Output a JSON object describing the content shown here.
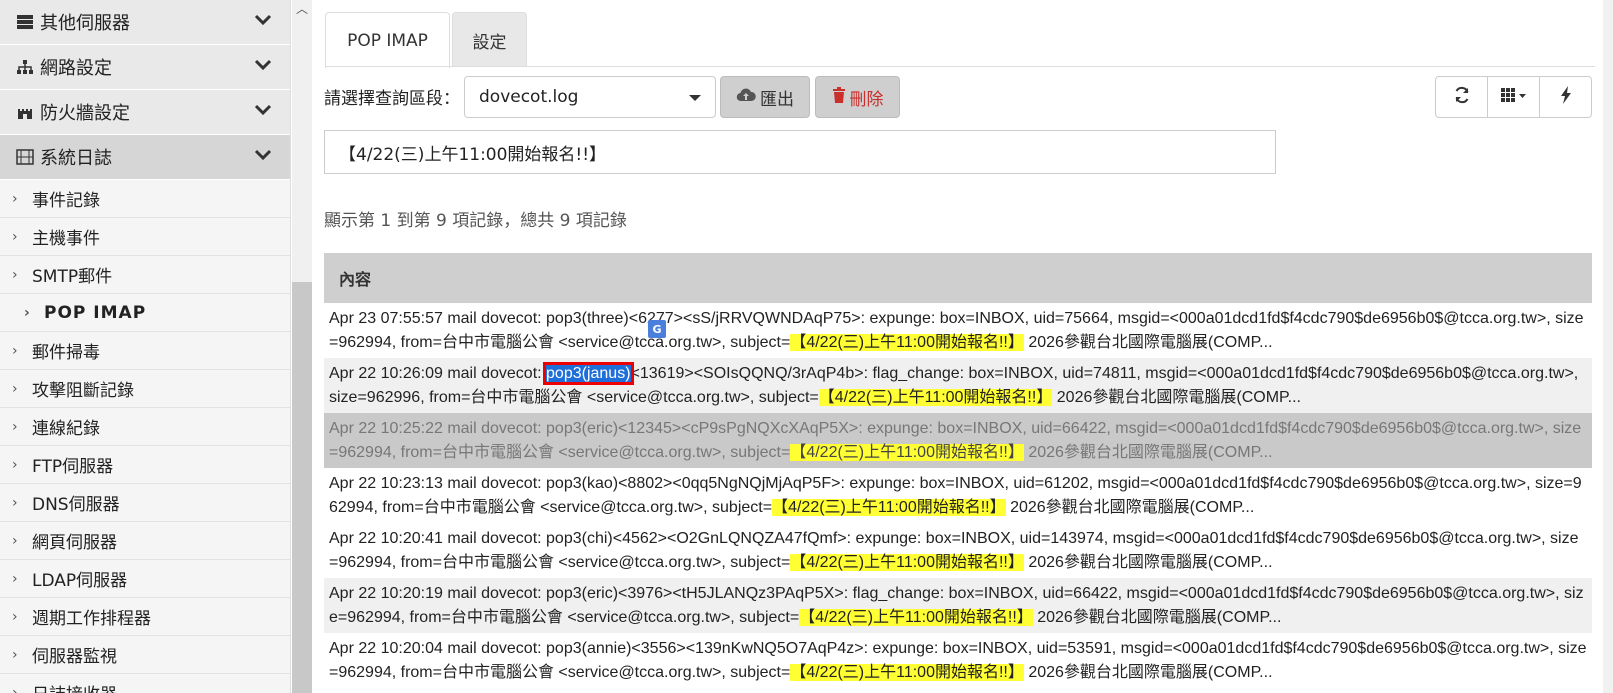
{
  "sidebar": {
    "sections": [
      {
        "label": "其他伺服器",
        "icon": "server-icon"
      },
      {
        "label": "網路設定",
        "icon": "network-icon"
      },
      {
        "label": "防火牆設定",
        "icon": "castle-icon"
      },
      {
        "label": "系統日誌",
        "icon": "film-icon"
      }
    ],
    "items": [
      {
        "label": "事件記錄"
      },
      {
        "label": "主機事件"
      },
      {
        "label": "SMTP郵件"
      },
      {
        "label": "POP IMAP"
      },
      {
        "label": "郵件掃毒"
      },
      {
        "label": "攻擊阻斷記錄"
      },
      {
        "label": "連線紀錄"
      },
      {
        "label": "FTP伺服器"
      },
      {
        "label": "DNS伺服器"
      },
      {
        "label": "網頁伺服器"
      },
      {
        "label": "LDAP伺服器"
      },
      {
        "label": "週期工作排程器"
      },
      {
        "label": "伺服器監視"
      },
      {
        "label": "日誌接收器"
      }
    ]
  },
  "tabs": [
    {
      "label": "POP IMAP"
    },
    {
      "label": "設定"
    }
  ],
  "toolbar": {
    "query_label": "請選擇查詢區段：",
    "selected_log": "dovecot.log",
    "export_label": "匯出",
    "delete_label": "刪除"
  },
  "search": {
    "value": "【4/22(三)上午11:00開始報名!!】"
  },
  "record_info": "顯示第 1 到第 9 項記錄，總共 9 項記錄",
  "table": {
    "header": "內容",
    "rows": [
      {
        "pre": "Apr 23 07:55:57 mail dovecot: pop3(three)<6277><sS/jRRVQWNDAqP75>: expunge: box=INBOX, uid=75664, msgid=<000a01dcd1fd$f4cdc790$de6956b0$@tcca.org.tw>, size=962994, from=台中市電腦公會 <se",
        "mid": "rvice@tcca.org.tw>, subject=",
        "hl": "【4/22(三)上午11:00開始報名!!】",
        "post": " 2026參觀台北國際電腦展(COMP..."
      },
      {
        "pre": "Apr 22 10:26:09 mail dovecot: ",
        "sel": "pop3(janus)",
        "mid": "<13619><SOIsQQNQ/3rAqP4b>: flag_change: box=INBOX, uid=74811, msgid=<000a01dcd1fd$f4cdc790$de6956b0$@tcca.org.tw>, size=962996, from=台中市電腦公會 <service@tcca.org.tw>, subject=",
        "hl": "【4/22(三)上午11:00開始報名!!】",
        "post": " 2026參觀台北國際電腦展(COMP..."
      },
      {
        "pre": "Apr 22 10:25:22 mail dovecot: pop3(eric)<12345><cP9sPgNQXcXAqP5X>: expunge: box=INBOX, uid=66422, msgid=<000a01dcd1fd$f4cdc790$de6956b0$@tcca.org.tw>, size=962994, from=台中市電腦公會 <service@tcca.org.tw>, subject=",
        "hl": "【4/22(三)上午11:00開始報名!!】",
        "post": " 2026參觀台北國際電腦展(COMP..."
      },
      {
        "pre": "Apr 22 10:23:13 mail dovecot: pop3(kao)<8802><0qq5NgNQjMjAqP5F>: expunge: box=INBOX, uid=61202, msgid=<000a01dcd1fd$f4cdc790$de6956b0$@tcca.org.tw>, size=962994, from=台中市電腦公會 <service@tcca.org.tw>, subject=",
        "hl": "【4/22(三)上午11:00開始報名!!】",
        "post": " 2026參觀台北國際電腦展(COMP..."
      },
      {
        "pre": "Apr 22 10:20:41 mail dovecot: pop3(chi)<4562><O2GnLQNQZA47fQmf>: expunge: box=INBOX, uid=143974, msgid=<000a01dcd1fd$f4cdc790$de6956b0$@tcca.org.tw>, size=962994, from=台中市電腦公會 <service@tcca.org.tw>, subject=",
        "hl": "【4/22(三)上午11:00開始報名!!】",
        "post": " 2026參觀台北國際電腦展(COMP..."
      },
      {
        "pre": "Apr 22 10:20:19 mail dovecot: pop3(eric)<3976><tH5JLANQz3PAqP5X>: flag_change: box=INBOX, uid=66422, msgid=<000a01dcd1fd$f4cdc790$de6956b0$@tcca.org.tw>, size=962994, from=台中市電腦公會 <service@tcca.org.tw>, subject=",
        "hl": "【4/22(三)上午11:00開始報名!!】",
        "post": " 2026參觀台北國際電腦展(COMP..."
      },
      {
        "pre": "Apr 22 10:20:04 mail dovecot: pop3(annie)<3556><139nKwNQ5O7AqP4z>: expunge: box=INBOX, uid=53591, msgid=<000a01dcd1fd$f4cdc790$de6956b0$@tcca.org.tw>, size=962994, from=台中市電腦公會 <service@tcca.org.tw>, subject=",
        "hl": "【4/22(三)上午11:00開始報名!!】",
        "post": " 2026參觀台北國際電腦展(COMP..."
      }
    ]
  },
  "colors": {
    "highlight": "#ffff33",
    "selection_outline": "#e00000",
    "delete": "#c9302c"
  }
}
